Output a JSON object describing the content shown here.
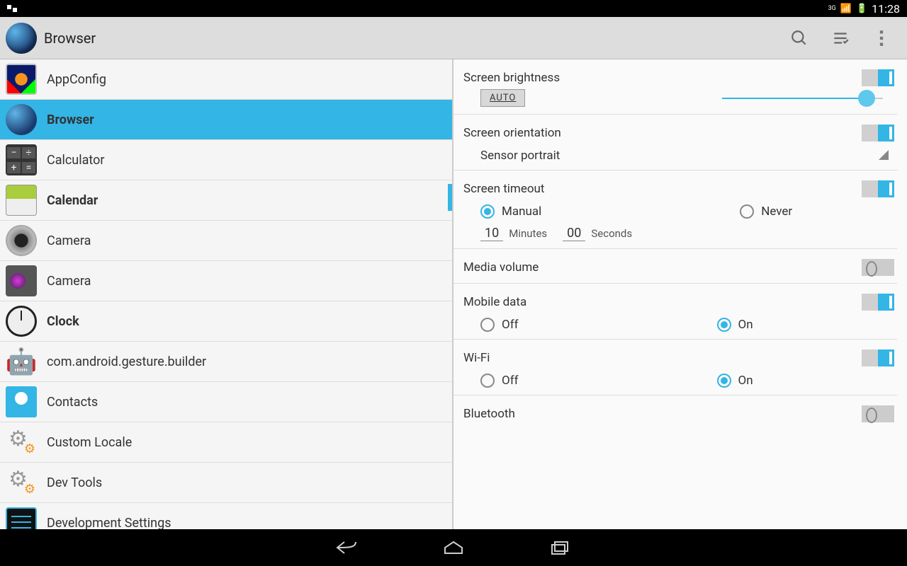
{
  "statusbar": {
    "network": "3G",
    "time": "11:28"
  },
  "actionbar": {
    "title": "Browser"
  },
  "apps": [
    {
      "label": "AppConfig",
      "icon": "i-appconfig",
      "selected": false,
      "bold": false
    },
    {
      "label": "Browser",
      "icon": "i-browser",
      "selected": true,
      "bold": true
    },
    {
      "label": "Calculator",
      "icon": "i-calc",
      "selected": false,
      "bold": false
    },
    {
      "label": "Calendar",
      "icon": "i-calendar",
      "selected": false,
      "bold": true
    },
    {
      "label": "Camera",
      "icon": "i-camera1",
      "selected": false,
      "bold": false
    },
    {
      "label": "Camera",
      "icon": "i-camera2",
      "selected": false,
      "bold": false
    },
    {
      "label": "Clock",
      "icon": "i-clock",
      "selected": false,
      "bold": true
    },
    {
      "label": "com.android.gesture.builder",
      "icon": "i-android",
      "selected": false,
      "bold": false
    },
    {
      "label": "Contacts",
      "icon": "i-contacts",
      "selected": false,
      "bold": false
    },
    {
      "label": "Custom Locale",
      "icon": "i-gear",
      "selected": false,
      "bold": false
    },
    {
      "label": "Dev Tools",
      "icon": "i-gear",
      "selected": false,
      "bold": false
    },
    {
      "label": "Development Settings",
      "icon": "i-sliders",
      "selected": false,
      "bold": false
    }
  ],
  "settings": {
    "brightness": {
      "label": "Screen brightness",
      "auto": "AUTO",
      "on": true,
      "pct": 90
    },
    "orientation": {
      "label": "Screen orientation",
      "value": "Sensor portrait",
      "on": true
    },
    "timeout": {
      "label": "Screen timeout",
      "on": true,
      "opts": {
        "manual": "Manual",
        "never": "Never",
        "selected": "manual"
      },
      "minutes": "10",
      "seconds": "00",
      "min_label": "Minutes",
      "sec_label": "Seconds"
    },
    "media": {
      "label": "Media volume",
      "on": false
    },
    "mobile": {
      "label": "Mobile data",
      "on": true,
      "opts": {
        "off": "Off",
        "on": "On",
        "selected": "on"
      }
    },
    "wifi": {
      "label": "Wi-Fi",
      "on": true,
      "opts": {
        "off": "Off",
        "on": "On",
        "selected": "on"
      }
    },
    "bt": {
      "label": "Bluetooth",
      "on": false
    }
  }
}
